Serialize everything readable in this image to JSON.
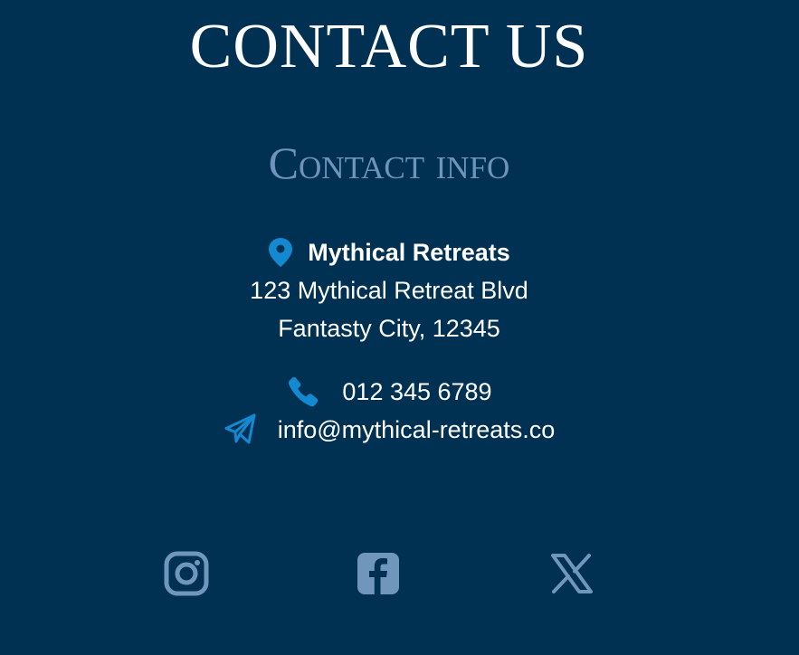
{
  "page": {
    "title": "CONTACT US",
    "section_title": "Contact info"
  },
  "contact": {
    "business_name": "Mythical Retreats",
    "address_line1": "123 Mythical Retreat Blvd",
    "address_line2": "Fantasty City, 12345",
    "phone": "012 345 6789",
    "email": "info@mythical-retreats.co"
  },
  "icons": {
    "address": "map-pin-icon",
    "phone": "phone-icon",
    "email": "paper-plane-icon",
    "social": [
      "instagram-icon",
      "facebook-icon",
      "x-icon"
    ]
  },
  "colors": {
    "background": "#003153",
    "heading": "#ffffff",
    "section_title": "#6e94bd",
    "accent_icon": "#1289d0",
    "social_icon": "#7096bd"
  }
}
